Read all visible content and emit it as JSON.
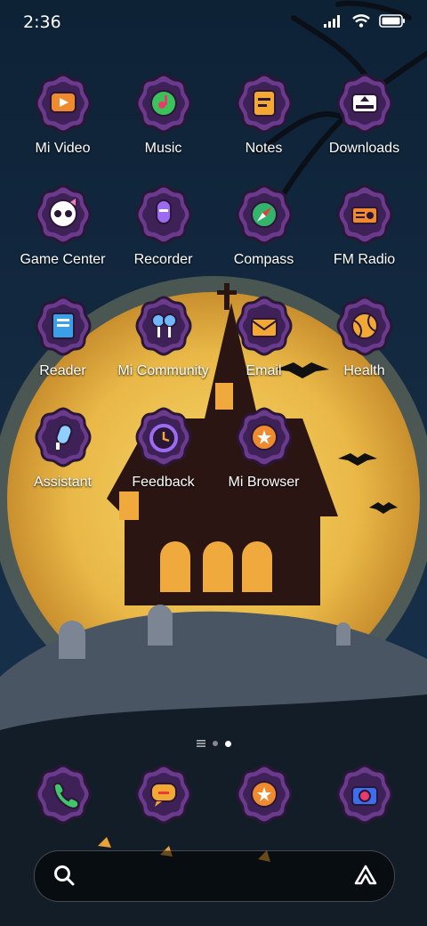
{
  "status": {
    "time": "2:36"
  },
  "apps": [
    [
      {
        "label": "Mi Video",
        "icon": "video-icon"
      },
      {
        "label": "Music",
        "icon": "music-icon"
      },
      {
        "label": "Notes",
        "icon": "notes-icon"
      },
      {
        "label": "Downloads",
        "icon": "downloads-icon"
      }
    ],
    [
      {
        "label": "Game Center",
        "icon": "skull-icon"
      },
      {
        "label": "Recorder",
        "icon": "microphone-icon"
      },
      {
        "label": "Compass",
        "icon": "compass-icon"
      },
      {
        "label": "FM Radio",
        "icon": "radio-icon"
      }
    ],
    [
      {
        "label": "Reader",
        "icon": "book-icon"
      },
      {
        "label": "Mi Community",
        "icon": "community-icon"
      },
      {
        "label": "Email",
        "icon": "envelope-icon"
      },
      {
        "label": "Health",
        "icon": "tennis-ball-icon"
      }
    ],
    [
      {
        "label": "Assistant",
        "icon": "assistant-icon"
      },
      {
        "label": "Feedback",
        "icon": "feedback-icon"
      },
      {
        "label": "Mi Browser",
        "icon": "browser-icon"
      }
    ]
  ],
  "dock": [
    {
      "icon": "phone-icon"
    },
    {
      "icon": "messages-icon"
    },
    {
      "icon": "browser-icon"
    },
    {
      "icon": "camera-icon"
    }
  ],
  "colors": {
    "badge": "#6a3a8c",
    "badge_dark": "#3e2156",
    "moon": "#f2c94c",
    "sky": "#0f2236"
  }
}
